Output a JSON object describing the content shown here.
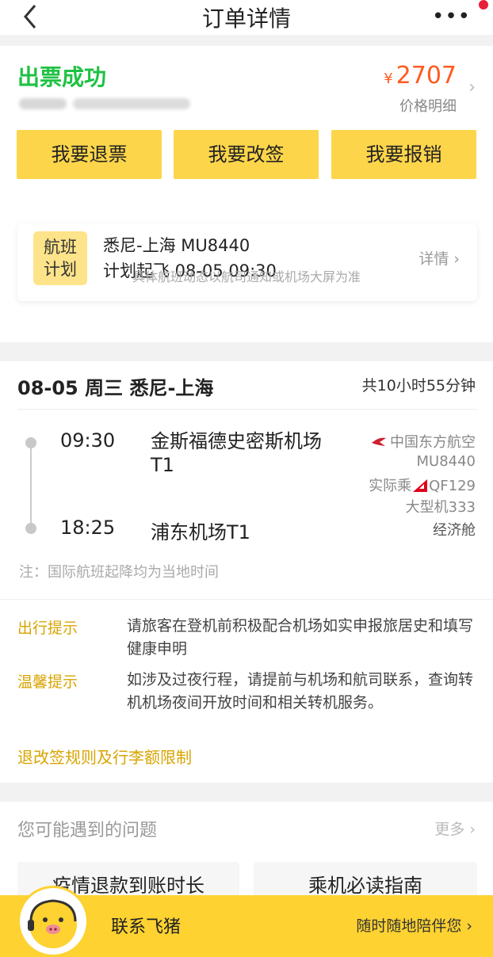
{
  "header": {
    "back_icon": "chevron-left-icon",
    "title": "订单详情",
    "more_label": "•••",
    "notification_dot_color": "#e8203a"
  },
  "order": {
    "status": "出票成功",
    "status_color": "#1ec243",
    "price_symbol": "¥",
    "price": "2707",
    "price_detail": "价格明细",
    "arrow": "›"
  },
  "actions": [
    {
      "label": "我要退票"
    },
    {
      "label": "我要改签"
    },
    {
      "label": "我要报销"
    }
  ],
  "flight_plan": {
    "badge": "航班计划",
    "route": "悉尼-上海 MU8440",
    "scheduled": "计划起飞 08-05 09:30",
    "detail": "详情 ›",
    "note": "具体航班动态以航司通知或机场大屏为准"
  },
  "flight": {
    "date_route": "08-05 周三 悉尼-上海",
    "duration": "共10小时55分钟",
    "dep_time": "09:30",
    "dep_airport": "金斯福德史密斯机场T1",
    "arr_time": "18:25",
    "arr_airport": "浦东机场T1",
    "airline": "中国东方航空",
    "flight_no": "MU8440",
    "actual_prefix": "实际乘",
    "actual_flight": "QF129",
    "aircraft": "大型机333",
    "cabin": "经济舱",
    "note": "注：国际航班起降均为当地时间"
  },
  "tips": [
    {
      "label": "出行提示",
      "text": "请旅客在登机前积极配合机场如实申报旅居史和填写健康申明"
    },
    {
      "label": "温馨提示",
      "text": "如涉及过夜行程，请提前与机场和航司联系，查询转机机场夜间开放时间和相关转机服务。"
    }
  ],
  "rules_link": "退改签规则及行李额限制",
  "faq": {
    "title": "您可能遇到的问题",
    "more": "更多 ›",
    "items": [
      {
        "label": "疫情退款到账时长"
      },
      {
        "label": "乘机必读指南"
      }
    ]
  },
  "bottom": {
    "contact": "联系飞猪",
    "companion": "随时随地陪伴您 ›"
  },
  "colors": {
    "accent_yellow": "#fdd54a",
    "price_orange": "#ff5a1f",
    "tip_gold": "#d8a400"
  }
}
